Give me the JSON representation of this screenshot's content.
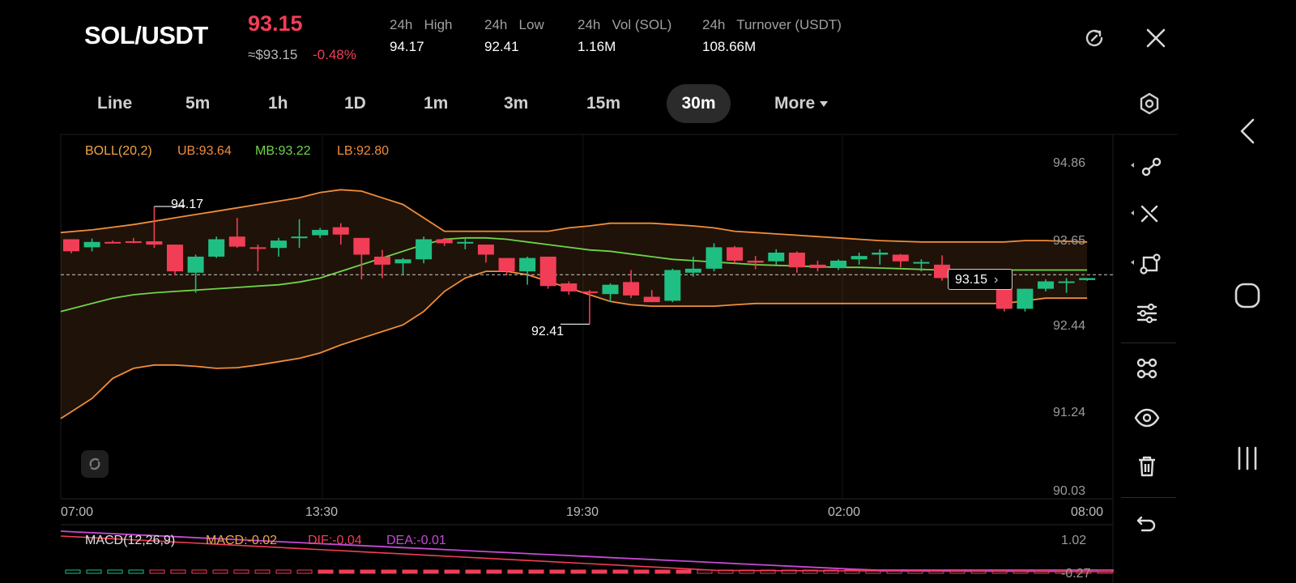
{
  "header": {
    "pair": "SOL/USDT",
    "price": "93.15",
    "usd_price": "≈$93.15",
    "change": "-0.48%",
    "stats": [
      {
        "label": "24h   High",
        "value": "94.17"
      },
      {
        "label": "24h   Low",
        "value": "92.41"
      },
      {
        "label": "24h   Vol (SOL)",
        "value": "1.16M"
      },
      {
        "label": "24h   Turnover (USDT)",
        "value": "108.66M"
      }
    ]
  },
  "tabs": [
    {
      "label": "Line"
    },
    {
      "label": "5m"
    },
    {
      "label": "1h"
    },
    {
      "label": "1D"
    },
    {
      "label": "1m"
    },
    {
      "label": "3m"
    },
    {
      "label": "15m"
    },
    {
      "label": "30m"
    },
    {
      "label": "More"
    }
  ],
  "active_tab": "30m",
  "icons": {
    "refresh": "refresh-icon",
    "close": "close-icon",
    "settings": "settings-hexagon-icon",
    "tools": [
      "line-tool-icon",
      "cross-line-tool-icon",
      "shape-tool-icon",
      "sliders-icon",
      "indicator-tool-icon",
      "eye-icon",
      "trash-icon",
      "undo-icon"
    ],
    "nav": [
      "back-icon",
      "home-icon",
      "recents-icon"
    ]
  },
  "colors": {
    "up": "#1fbf83",
    "down": "#f23d57",
    "ub": "#f08d3a",
    "mb": "#6fd44a",
    "dea": "#c64ad6",
    "accent": "#f23d57"
  },
  "chart_data": {
    "type": "candlestick",
    "legend": {
      "boll": "BOLL(20,2)",
      "ub": "UB:93.64",
      "mb": "MB:93.22",
      "lb": "LB:92.80"
    },
    "yticks": [
      "94.86",
      "93.65",
      "92.44",
      "91.24",
      "90.03"
    ],
    "ylim": [
      90.03,
      94.86
    ],
    "xticks": [
      "07:00",
      "13:30",
      "19:30",
      "02:00",
      "08:00"
    ],
    "high_marker": "94.17",
    "low_marker": "92.41",
    "last_price": "93.15",
    "candles": [
      [
        93.68,
        93.68,
        93.47,
        93.5
      ],
      [
        93.56,
        93.69,
        93.5,
        93.64
      ],
      [
        93.64,
        93.66,
        93.62,
        93.63
      ],
      [
        93.65,
        93.7,
        93.62,
        93.64
      ],
      [
        93.65,
        94.17,
        93.55,
        93.6
      ],
      [
        93.6,
        93.6,
        93.14,
        93.2
      ],
      [
        93.18,
        93.45,
        92.88,
        93.42
      ],
      [
        93.42,
        93.72,
        93.4,
        93.68
      ],
      [
        93.72,
        94.0,
        93.55,
        93.57
      ],
      [
        93.56,
        93.6,
        93.2,
        93.55
      ],
      [
        93.55,
        93.7,
        93.42,
        93.66
      ],
      [
        93.7,
        93.98,
        93.55,
        93.72
      ],
      [
        93.74,
        93.85,
        93.7,
        93.82
      ],
      [
        93.86,
        93.92,
        93.6,
        93.75
      ],
      [
        93.7,
        93.7,
        93.08,
        93.45
      ],
      [
        93.42,
        93.52,
        93.1,
        93.3
      ],
      [
        93.32,
        93.4,
        93.16,
        93.38
      ],
      [
        93.38,
        93.72,
        93.32,
        93.68
      ],
      [
        93.68,
        93.7,
        93.58,
        93.62
      ],
      [
        93.62,
        93.7,
        93.53,
        93.64
      ],
      [
        93.6,
        93.6,
        93.33,
        93.45
      ],
      [
        93.4,
        93.4,
        93.14,
        93.2
      ],
      [
        93.2,
        93.42,
        93.0,
        93.4
      ],
      [
        93.42,
        93.42,
        92.94,
        92.98
      ],
      [
        93.02,
        93.05,
        92.85,
        92.9
      ],
      [
        92.9,
        92.92,
        92.41,
        92.88
      ],
      [
        92.86,
        93.02,
        92.74,
        93.0
      ],
      [
        93.04,
        93.22,
        92.8,
        92.84
      ],
      [
        92.82,
        92.92,
        92.74,
        92.74
      ],
      [
        92.76,
        93.24,
        92.74,
        93.22
      ],
      [
        93.18,
        93.42,
        93.12,
        93.24
      ],
      [
        93.24,
        93.62,
        93.2,
        93.56
      ],
      [
        93.56,
        93.58,
        93.32,
        93.36
      ],
      [
        93.36,
        93.43,
        93.23,
        93.33
      ],
      [
        93.35,
        93.53,
        93.3,
        93.48
      ],
      [
        93.48,
        93.5,
        93.18,
        93.26
      ],
      [
        93.3,
        93.36,
        93.2,
        93.25
      ],
      [
        93.25,
        93.38,
        93.22,
        93.36
      ],
      [
        93.38,
        93.48,
        93.3,
        93.43
      ],
      [
        93.45,
        93.53,
        93.3,
        93.48
      ],
      [
        93.45,
        93.46,
        93.26,
        93.35
      ],
      [
        93.34,
        93.38,
        93.2,
        93.34
      ],
      [
        93.3,
        93.44,
        93.06,
        93.1
      ],
      [
        93.14,
        93.2,
        92.98,
        93.16
      ],
      [
        93.12,
        93.14,
        92.98,
        93.02
      ],
      [
        92.98,
        93.0,
        92.6,
        92.64
      ],
      [
        92.64,
        92.94,
        92.6,
        92.94
      ],
      [
        92.94,
        93.08,
        92.9,
        93.05
      ],
      [
        93.05,
        93.1,
        92.88,
        93.05
      ],
      [
        93.07,
        93.1,
        93.06,
        93.1
      ]
    ],
    "ub_line": [
      93.78,
      93.82,
      93.86,
      93.9,
      93.95,
      94.0,
      94.05,
      94.1,
      94.15,
      94.2,
      94.25,
      94.3,
      94.38,
      94.42,
      94.4,
      94.3,
      94.2,
      94.0,
      93.8,
      93.8,
      93.8,
      93.8,
      93.8,
      93.8,
      93.85,
      93.88,
      93.92,
      93.92,
      93.92,
      93.9,
      93.88,
      93.85,
      93.8,
      93.78,
      93.76,
      93.74,
      93.72,
      93.7,
      93.68,
      93.66,
      93.65,
      93.64,
      93.64,
      93.64,
      93.64,
      93.64,
      93.66,
      93.66,
      93.65,
      93.64
    ],
    "mb_line": [
      92.6,
      92.72,
      92.8,
      92.85,
      92.88,
      92.9,
      92.92,
      92.94,
      92.96,
      92.98,
      93.0,
      93.04,
      93.1,
      93.2,
      93.3,
      93.4,
      93.5,
      93.6,
      93.68,
      93.7,
      93.7,
      93.68,
      93.64,
      93.6,
      93.56,
      93.52,
      93.5,
      93.46,
      93.42,
      93.38,
      93.36,
      93.34,
      93.32,
      93.3,
      93.29,
      93.28,
      93.27,
      93.26,
      93.26,
      93.25,
      93.24,
      93.23,
      93.22,
      93.22,
      93.22,
      93.22,
      93.22,
      93.22,
      93.22,
      93.22
    ],
    "lb_line": [
      91.0,
      91.3,
      91.6,
      91.75,
      91.8,
      91.8,
      91.78,
      91.75,
      91.76,
      91.8,
      91.85,
      91.9,
      91.98,
      92.1,
      92.2,
      92.3,
      92.4,
      92.6,
      92.9,
      93.1,
      93.2,
      93.2,
      93.15,
      93.05,
      92.95,
      92.85,
      92.75,
      92.7,
      92.68,
      92.68,
      92.68,
      92.68,
      92.7,
      92.72,
      92.72,
      92.72,
      92.72,
      92.72,
      92.72,
      92.72,
      92.72,
      92.72,
      92.72,
      92.72,
      92.72,
      92.72,
      92.76,
      92.8,
      92.8,
      92.8
    ],
    "macd": {
      "legend": {
        "name": "MACD(12,26,9)",
        "macd": "MACD:-0.02",
        "dif": "DIF:-0.04",
        "dea": "DEA:-0.01"
      },
      "yticks": [
        "1.02",
        "-0.27"
      ]
    }
  }
}
